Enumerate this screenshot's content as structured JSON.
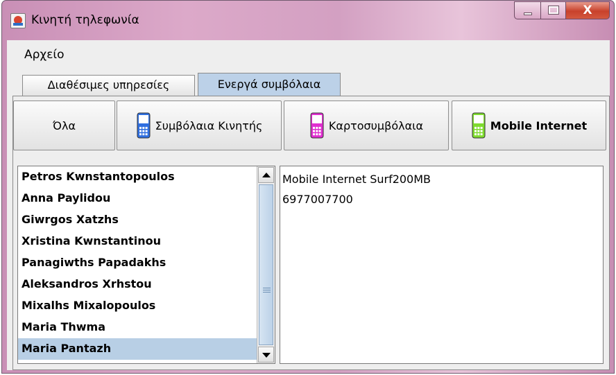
{
  "window": {
    "title": "Κινητή τηλεφωνία",
    "close_glyph": "X"
  },
  "menu": {
    "file_label": "Αρχείο"
  },
  "tabs": [
    {
      "label": "Διαθέσιμες υπηρεσίες",
      "selected": false
    },
    {
      "label": "Ενεργά συμβόλαια",
      "selected": true
    }
  ],
  "filters": [
    {
      "label": "Όλα",
      "icon": null
    },
    {
      "label": "Συμβόλαια Κινητής",
      "icon": "mobile-phone-blue-icon",
      "color": "#2f6fe0"
    },
    {
      "label": "Καρτοσυμβόλαια",
      "icon": "mobile-phone-magenta-icon",
      "color": "#e02fd0"
    },
    {
      "label": "Mobile Internet",
      "icon": "mobile-phone-green-icon",
      "color": "#7fdc2f"
    }
  ],
  "customers": [
    "Petros Kwnstantopoulos",
    "Anna Paylidou",
    "Giwrgos Xatzhs",
    "Xristina Kwnstantinou",
    "Panagiwths Papadakhs",
    "Aleksandros Xrhstou",
    "Mixalhs Mixalopoulos",
    "Maria Thwma",
    "Maria Pantazh"
  ],
  "selected_customer_index": 8,
  "details": {
    "plan": "Mobile Internet Surf200MB",
    "number": "6977007700"
  },
  "colors": {
    "selection": "#b8cfe5",
    "selected_tab": "#bcd1e8",
    "title_bar": "#d3a0c2",
    "close_button": "#c8412b"
  }
}
